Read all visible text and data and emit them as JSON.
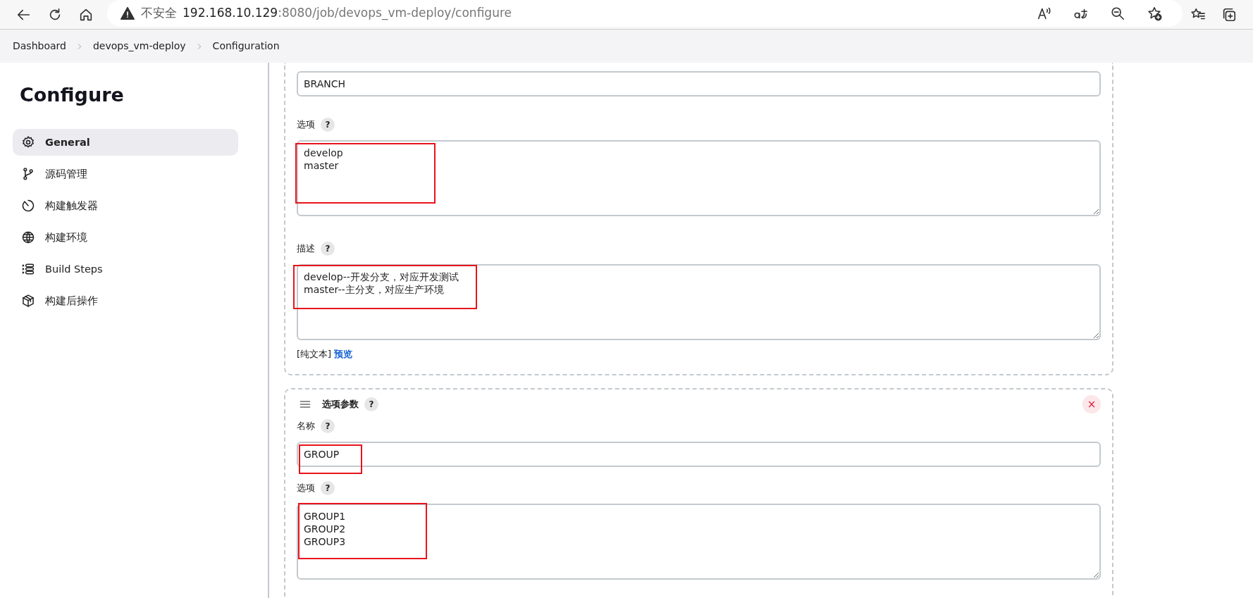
{
  "browser": {
    "security_label": "不安全",
    "url_host": "192.168.10.129",
    "url_path": ":8080/job/devops_vm-deploy/configure"
  },
  "breadcrumbs": [
    {
      "label": "Dashboard"
    },
    {
      "label": "devops_vm-deploy"
    },
    {
      "label": "Configuration"
    }
  ],
  "sidebar": {
    "title": "Configure",
    "items": [
      {
        "label": "General",
        "selected": true
      },
      {
        "label": "源码管理",
        "selected": false
      },
      {
        "label": "构建触发器",
        "selected": false
      },
      {
        "label": "构建环境",
        "selected": false
      },
      {
        "label": "Build Steps",
        "selected": false
      },
      {
        "label": "构建后操作",
        "selected": false
      }
    ]
  },
  "sections": [
    {
      "kind": "continued",
      "fields": [
        {
          "kind": "input",
          "value": "BRANCH",
          "highlighted": false
        },
        {
          "kind": "textarea",
          "label": "选项",
          "help": "?",
          "value": "develop\nmaster",
          "highlighted": true
        },
        {
          "kind": "textarea",
          "label": "描述",
          "help": "?",
          "value": "develop--开发分支，对应开发测试\nmaster--主分支，对应生产环境",
          "highlighted": true,
          "footer": {
            "text": "[纯文本]",
            "link": "预览"
          }
        }
      ]
    },
    {
      "kind": "parameter",
      "title": "选项参数",
      "help": "?",
      "close": "×",
      "fields": [
        {
          "kind": "input",
          "label": "名称",
          "help": "?",
          "value": "GROUP",
          "highlighted": true
        },
        {
          "kind": "textarea",
          "label": "选项",
          "help": "?",
          "value": "GROUP1\nGROUP2\nGROUP3",
          "highlighted": true
        }
      ]
    }
  ]
}
